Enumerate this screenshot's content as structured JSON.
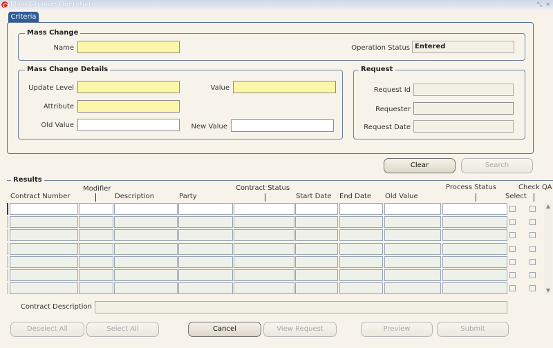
{
  "window": {
    "title": "Mass Change Operation",
    "controls": [
      "⤡",
      "×"
    ]
  },
  "tab": {
    "label": "Criteria"
  },
  "mass_change": {
    "legend": "Mass Change",
    "name_label": "Name",
    "name_value": "",
    "status_label": "Operation Status",
    "status_value": "Entered"
  },
  "details": {
    "legend": "Mass Change Details",
    "update_level_label": "Update Level",
    "value_label": "Value",
    "attribute_label": "Attribute",
    "old_value_label": "Old Value",
    "new_value_label": "New Value"
  },
  "request": {
    "legend": "Request",
    "request_id_label": "Request Id",
    "requester_label": "Requester",
    "request_date_label": "Request Date"
  },
  "criteria_buttons": {
    "clear": "Clear",
    "search": "Search"
  },
  "results": {
    "legend": "Results",
    "columns": {
      "contract_number": "Contract Number",
      "modifier": "Modifier",
      "description": "Description",
      "party": "Party",
      "contract_status": "Contract Status",
      "start_date": "Start Date",
      "end_date": "End Date",
      "old_value": "Old Value",
      "process_status": "Process Status",
      "select": "Select",
      "check_qa": "Check QA"
    },
    "row_count": 7
  },
  "contract_description": {
    "label": "Contract Description",
    "value": ""
  },
  "bottom_buttons": {
    "deselect_all": "Deselect All",
    "select_all": "Select All",
    "cancel": "Cancel",
    "view_request": "View Request",
    "preview": "Preview",
    "submit": "Submit"
  }
}
